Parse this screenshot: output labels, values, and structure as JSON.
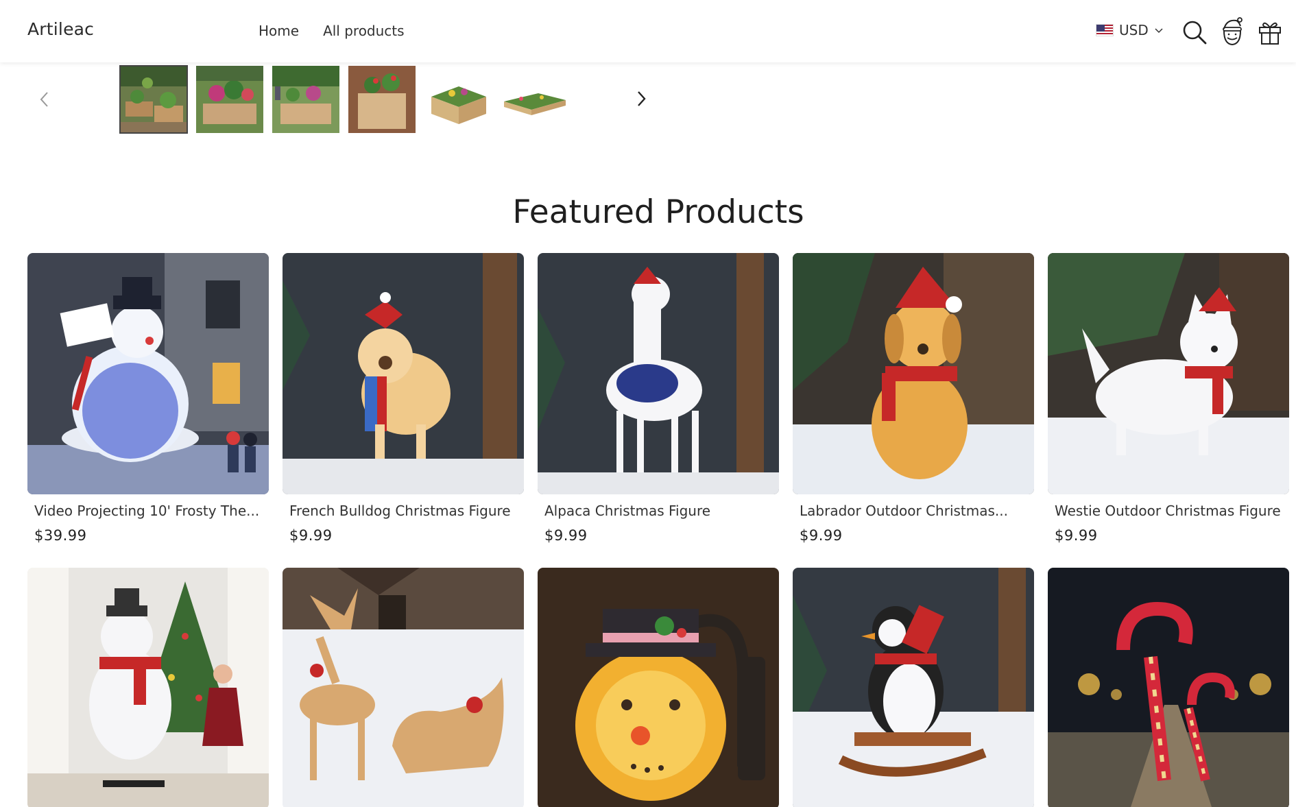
{
  "header": {
    "logo": "Artileac",
    "nav": [
      {
        "label": "Home"
      },
      {
        "label": "All products"
      }
    ],
    "currency": {
      "code": "USD",
      "flag": "us-flag-icon"
    },
    "icons": [
      "search-icon",
      "santa-account-icon",
      "gift-cart-icon"
    ]
  },
  "gallery": {
    "thumbnails": [
      {
        "name": "garden-bed-thumb-1",
        "active": true
      },
      {
        "name": "garden-bed-thumb-2",
        "active": false
      },
      {
        "name": "garden-bed-thumb-3",
        "active": false
      },
      {
        "name": "garden-bed-thumb-4",
        "active": false
      },
      {
        "name": "garden-bed-thumb-5",
        "active": false
      },
      {
        "name": "garden-bed-thumb-6",
        "active": false
      }
    ]
  },
  "featured": {
    "title": "Featured Products",
    "products": [
      {
        "name": "Video Projecting 10' Frosty The...",
        "price": "$39.99"
      },
      {
        "name": "French Bulldog Christmas Figure",
        "price": "$9.99"
      },
      {
        "name": "Alpaca Christmas Figure",
        "price": "$9.99"
      },
      {
        "name": "Labrador Outdoor Christmas...",
        "price": "$9.99"
      },
      {
        "name": "Westie Outdoor Christmas Figure",
        "price": "$9.99"
      },
      {
        "name": "",
        "price": ""
      },
      {
        "name": "",
        "price": ""
      },
      {
        "name": "",
        "price": ""
      },
      {
        "name": "",
        "price": ""
      },
      {
        "name": "",
        "price": ""
      }
    ]
  },
  "colors": {
    "text": "#222222",
    "header_bg": "#ffffff",
    "accent_red": "#c62828"
  }
}
